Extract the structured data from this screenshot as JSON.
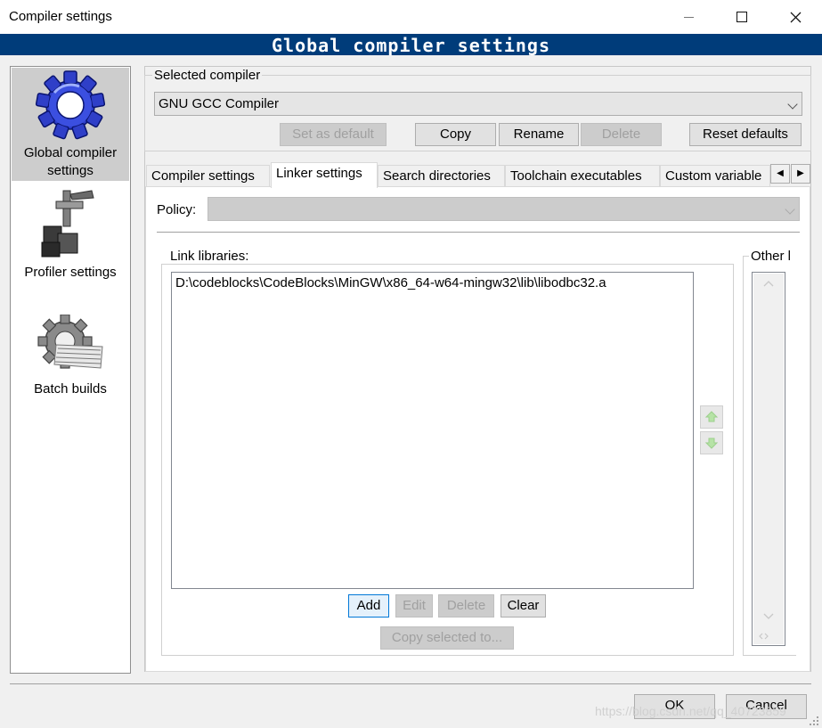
{
  "window": {
    "title": "Compiler settings",
    "banner": "Global compiler settings"
  },
  "sidebar": {
    "items": [
      {
        "label": "Global compiler settings",
        "icon": "gear-icon",
        "selected": true
      },
      {
        "label": "Profiler settings",
        "icon": "profiler-icon",
        "selected": false
      },
      {
        "label": "Batch builds",
        "icon": "batch-builds-icon",
        "selected": false
      }
    ]
  },
  "selected_compiler": {
    "group_label": "Selected compiler",
    "value": "GNU GCC Compiler",
    "buttons": {
      "set_default": "Set as default",
      "copy": "Copy",
      "rename": "Rename",
      "delete": "Delete",
      "reset": "Reset defaults"
    }
  },
  "tabs": [
    {
      "label": "Compiler settings",
      "active": false
    },
    {
      "label": "Linker settings",
      "active": true
    },
    {
      "label": "Search directories",
      "active": false
    },
    {
      "label": "Toolchain executables",
      "active": false
    },
    {
      "label": "Custom variable",
      "active": false
    }
  ],
  "linker": {
    "policy_label": "Policy:",
    "policy_value": "",
    "link_libraries_label": "Link libraries:",
    "link_libraries": [
      "D:\\codeblocks\\CodeBlocks\\MinGW\\x86_64-w64-mingw32\\lib\\libodbc32.a"
    ],
    "buttons": {
      "add": "Add",
      "edit": "Edit",
      "delete": "Delete",
      "clear": "Clear",
      "copy_selected": "Copy selected to..."
    },
    "other_label": "Other l"
  },
  "dialog_buttons": {
    "ok": "OK",
    "cancel": "Cancel"
  },
  "watermark": "https://blog.csdn.net/qq_40723859"
}
